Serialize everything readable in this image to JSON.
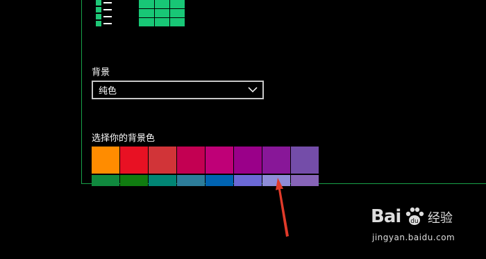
{
  "layout_options": [
    {
      "name": "list-layout",
      "icon": "list-icon"
    },
    {
      "name": "tiles-layout",
      "icon": "tiles-icon"
    }
  ],
  "background": {
    "label": "背景",
    "dropdown_value": "纯色",
    "dropdown_icon": "chevron-down-icon"
  },
  "accent": {
    "label": "选择你的背景色",
    "top_row": [
      "#ff8c00",
      "#e81123",
      "#d13438",
      "#c30052",
      "#bf0077",
      "#9a0089",
      "#881798",
      "#744da9"
    ],
    "bottom_row": [
      "#10893e",
      "#107c10",
      "#018574",
      "#2d7d9a",
      "#0063b1",
      "#6b69d6",
      "#8e8cd8",
      "#8764b8"
    ],
    "pointed_swatch_index": 6
  },
  "annotation": {
    "icon": "red-arrow-icon",
    "color": "#e03a2a"
  },
  "watermark": {
    "brand": "Bai",
    "brand_cn": "经验",
    "url": "jingyan.baidu.com"
  },
  "colors": {
    "accent_line": "#18a24a"
  }
}
